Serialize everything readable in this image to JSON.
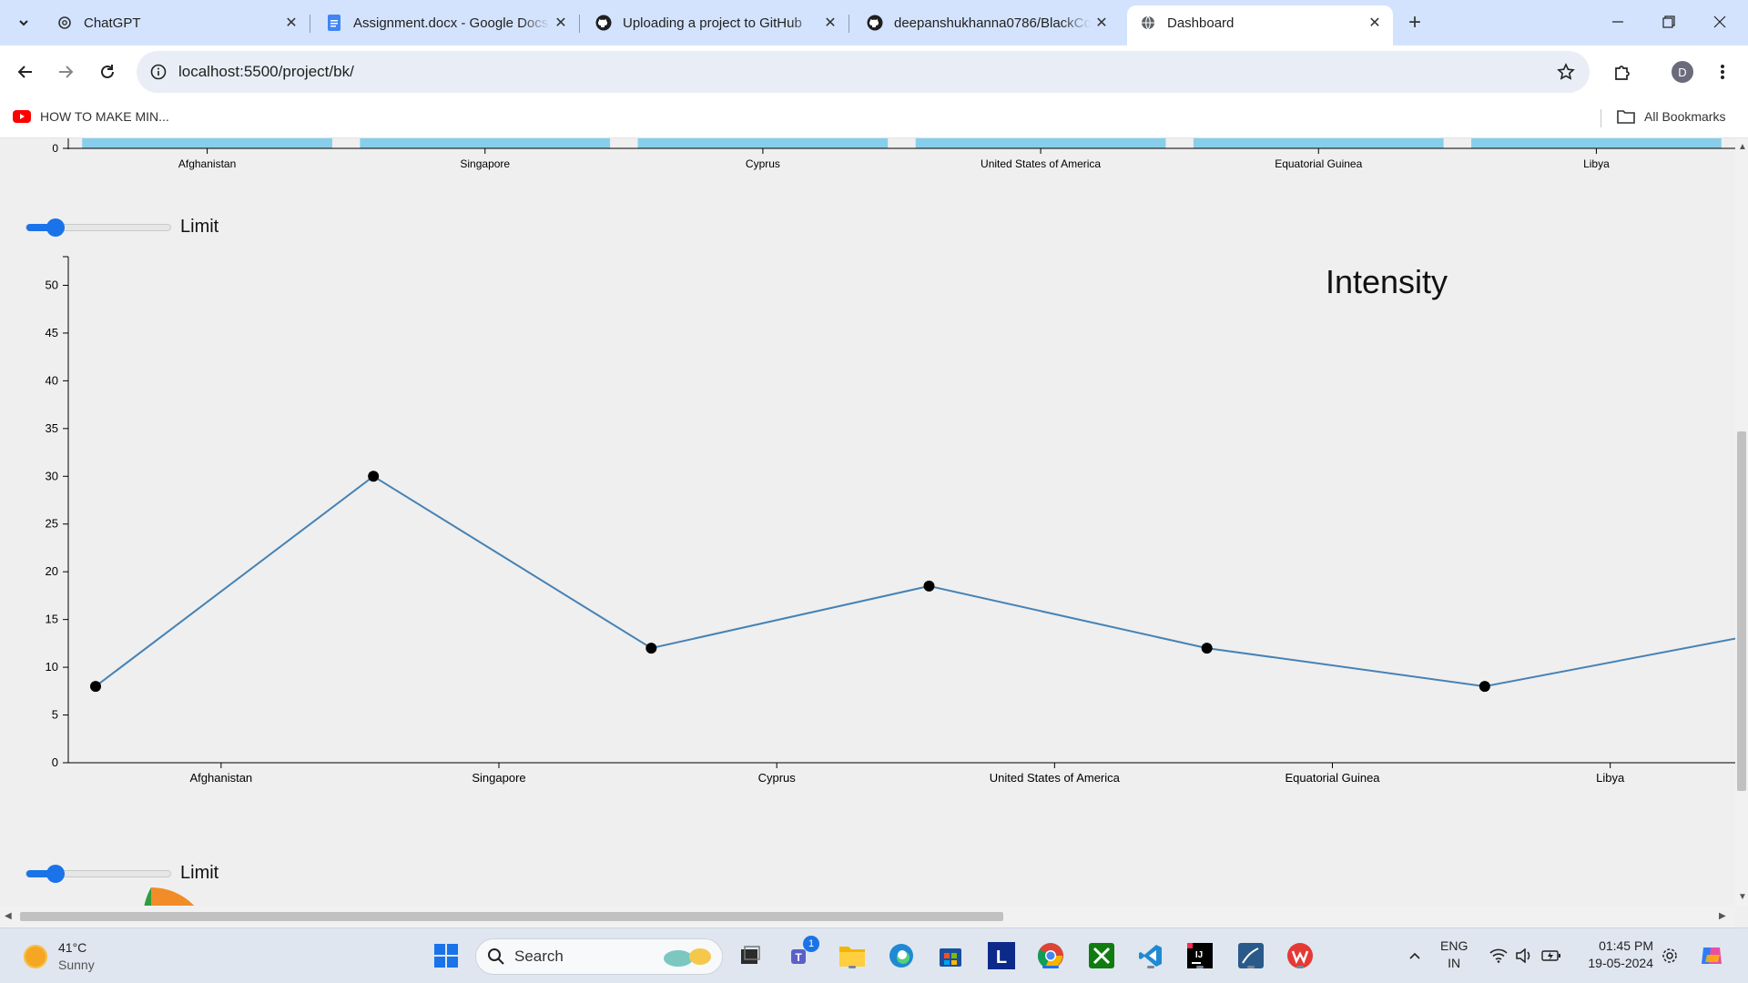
{
  "browser": {
    "tabs": [
      {
        "label": "ChatGPT",
        "icon": "chatgpt-icon"
      },
      {
        "label": "Assignment.docx - Google Docs",
        "icon": "google-docs-icon"
      },
      {
        "label": "Uploading a project to GitHub",
        "icon": "github-icon"
      },
      {
        "label": "deepanshukhanna0786/BlackCoffer",
        "icon": "github-icon"
      },
      {
        "label": "Dashboard",
        "icon": "globe-icon",
        "active": true
      }
    ],
    "url": "localhost:5500/project/bk/",
    "profile_initial": "D",
    "bookmarks": [
      {
        "label": "HOW TO MAKE MIN...",
        "icon": "youtube-icon"
      }
    ],
    "all_bookmarks_label": "All Bookmarks"
  },
  "page": {
    "top_bar_axis": {
      "categories": [
        "Afghanistan",
        "Singapore",
        "Cyprus",
        "United States of America",
        "Equatorial Guinea",
        "Libya"
      ],
      "y_tick": "0",
      "bar_color": "#87ceeb"
    },
    "limit_control_1": {
      "label": "Limit",
      "value": 0.2
    },
    "limit_control_2": {
      "label": "Limit",
      "value": 0.2
    }
  },
  "chart_data": {
    "type": "line",
    "title": "Intensity",
    "categories": [
      "Afghanistan",
      "Singapore",
      "Cyprus",
      "United States of America",
      "Equatorial Guinea",
      "Libya"
    ],
    "series": [
      {
        "values": [
          8,
          30,
          12,
          18.5,
          12,
          8,
          13
        ],
        "color": "#4682b4"
      }
    ],
    "yticks": [
      "0",
      "5",
      "10",
      "15",
      "20",
      "25",
      "30",
      "35",
      "40",
      "45",
      "50"
    ],
    "ylim": [
      0,
      53
    ],
    "grid": false,
    "point_color": "#000000"
  },
  "taskbar": {
    "weather": {
      "temp": "41°C",
      "condition": "Sunny"
    },
    "search_label": "Search",
    "teams_badge": "1",
    "language": {
      "line1": "ENG",
      "line2": "IN"
    },
    "time": "01:45 PM",
    "date": "19-05-2024"
  }
}
